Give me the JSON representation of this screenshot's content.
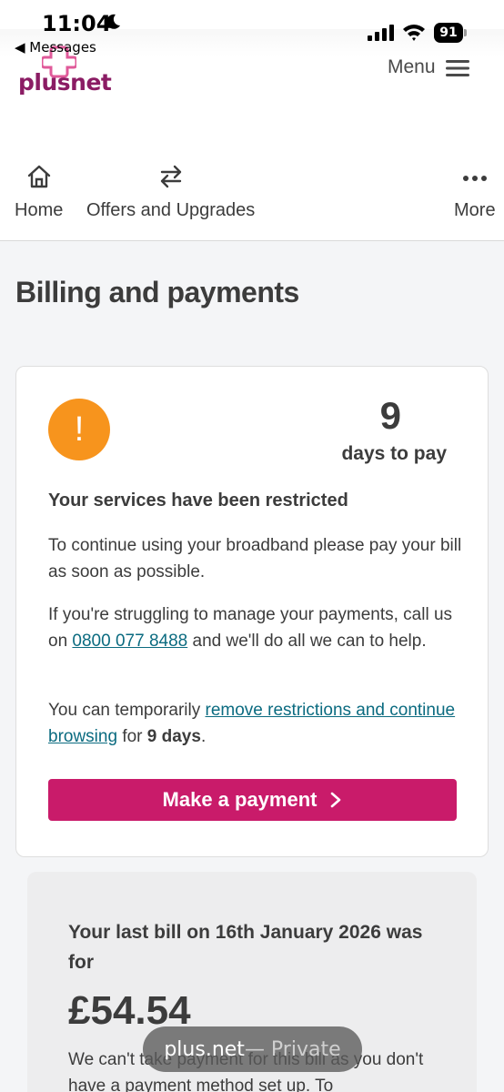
{
  "status_bar": {
    "time": "11:04",
    "back_label": "◀ Messages",
    "battery": "91"
  },
  "header": {
    "logo_text": "plusnet",
    "menu_label": "Menu",
    "brand_color": "#8b1c64"
  },
  "nav": {
    "items": [
      {
        "label": "Home",
        "icon": "home-icon"
      },
      {
        "label": "Offers and Upgrades",
        "icon": "swap-arrows-icon"
      },
      {
        "label": "More",
        "icon": "more-dots-icon"
      }
    ]
  },
  "page": {
    "title": "Billing and payments"
  },
  "alert_card": {
    "icon": "!",
    "days_number": "9",
    "days_label": "days to pay",
    "heading": "Your services have been restricted",
    "p1": "To continue using your broadband please pay your bill as soon as possible.",
    "p2_before": "If you're struggling to manage your payments, call us on ",
    "p2_phone": "0800 077 8488",
    "p2_after": " and we'll do all we can to help.",
    "p3_before": "You can temporarily ",
    "p3_link": "remove restrictions and continue browsing",
    "p3_mid": " for ",
    "p3_bold": "9 days",
    "p3_after": ".",
    "button_label": "Make a payment",
    "button_color": "#c91b6a",
    "alert_color": "#f7941d",
    "link_color": "#0b6b80"
  },
  "bill_card": {
    "title": "Your last bill on 16th January 2026 was for",
    "amount": "£54.54",
    "text": "We can't take payment for this bill as you don't have a payment method set up. To"
  },
  "browser": {
    "domain": "plus.net",
    "mode": " — Private"
  }
}
